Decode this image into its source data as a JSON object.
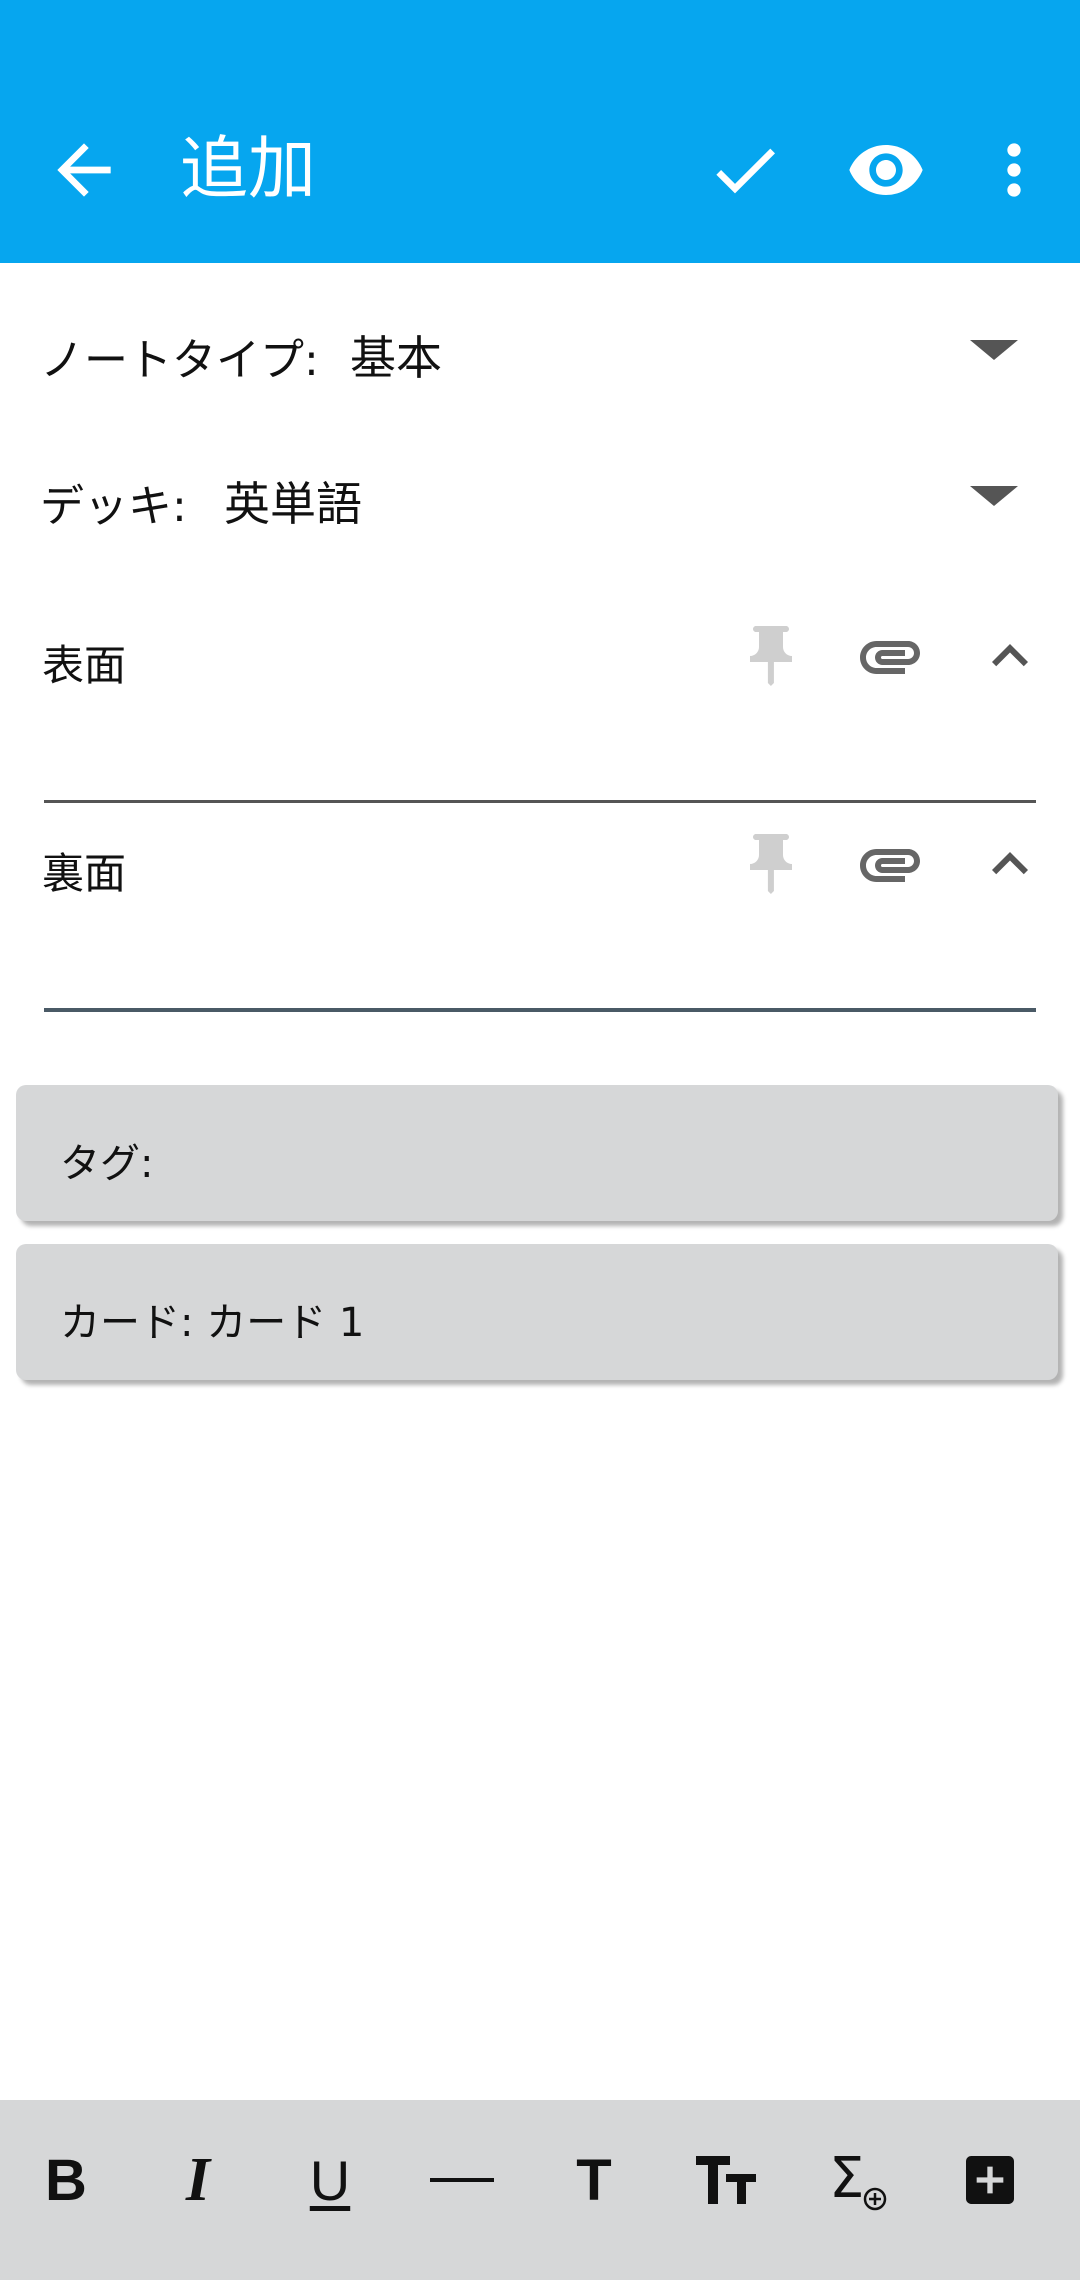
{
  "appbar": {
    "title": "追加",
    "color": "#06a6ef",
    "icons": [
      "back-arrow-icon",
      "check-icon",
      "eye-icon",
      "more-vert-icon"
    ]
  },
  "note_type": {
    "label": "ノートタイプ:",
    "value": "基本"
  },
  "deck": {
    "label": "デッキ:",
    "value": "英単語"
  },
  "fields": [
    {
      "label": "表面",
      "value": ""
    },
    {
      "label": "裏面",
      "value": ""
    }
  ],
  "tags": {
    "label": "タグ:"
  },
  "cards": {
    "label": "カード: カード 1"
  },
  "toolbar": {
    "bold": "B",
    "italic": "I",
    "underline": "U",
    "text": "T",
    "text_size": "TT",
    "icons": [
      "bold-icon",
      "italic-icon",
      "underline-icon",
      "horizontal-rule-icon",
      "text-icon",
      "text-size-icon",
      "math-icon",
      "add-box-icon"
    ]
  }
}
